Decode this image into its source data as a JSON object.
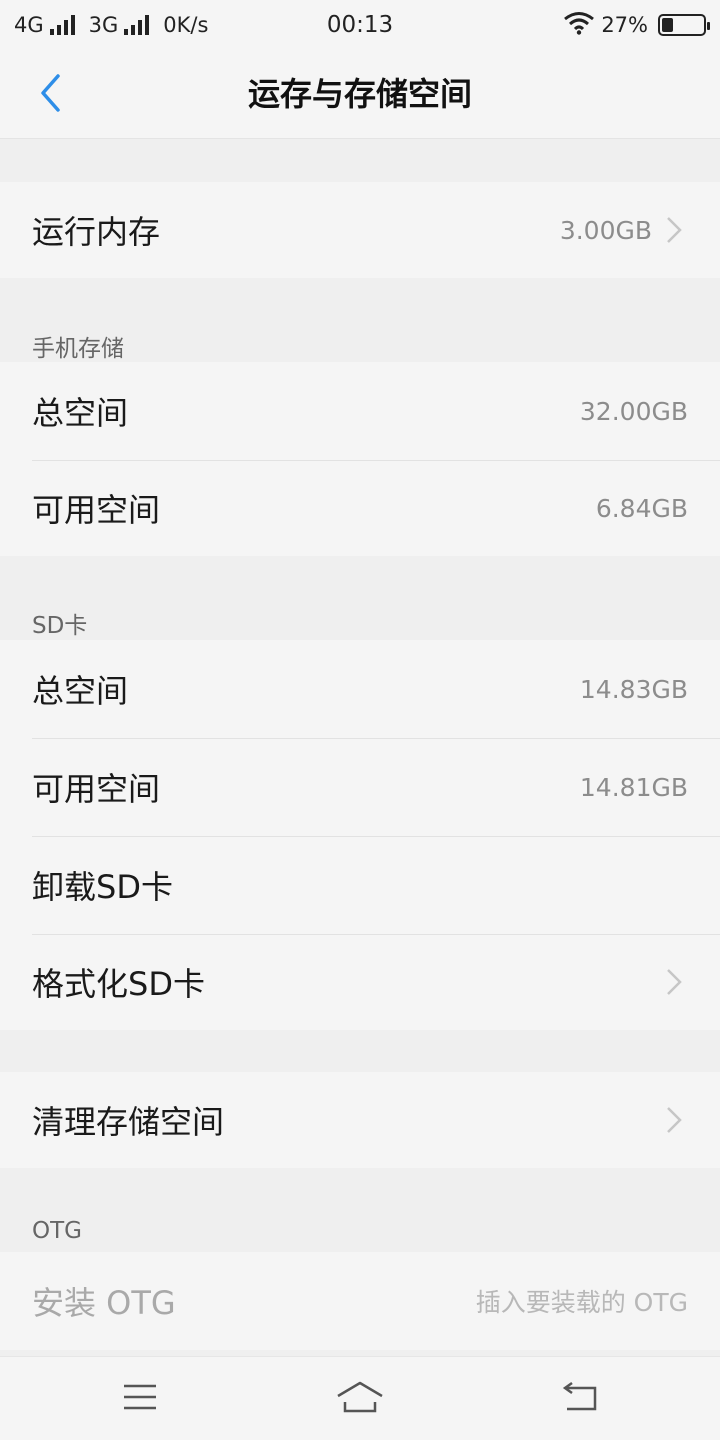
{
  "status_bar": {
    "network_1": "4G",
    "network_2": "3G",
    "speed": "0K/s",
    "time": "00:13",
    "battery_percent": "27%",
    "battery_level": 0.27
  },
  "header": {
    "title": "运存与存储空间",
    "back_icon": "chevron-left-icon",
    "accent_color": "#2e8ee8"
  },
  "ram": {
    "label": "运行内存",
    "value": "3.00GB"
  },
  "phone_storage": {
    "header": "手机存储",
    "total_label": "总空间",
    "total_value": "32.00GB",
    "available_label": "可用空间",
    "available_value": "6.84GB"
  },
  "sd_card": {
    "header": "SD卡",
    "total_label": "总空间",
    "total_value": "14.83GB",
    "available_label": "可用空间",
    "available_value": "14.81GB",
    "unmount_label": "卸载SD卡",
    "format_label": "格式化SD卡"
  },
  "cleanup": {
    "label": "清理存储空间"
  },
  "otg": {
    "header": "OTG",
    "install_label": "安装 OTG",
    "install_hint": "插入要装载的 OTG"
  },
  "nav": {
    "menu_icon": "menu-icon",
    "home_icon": "home-icon",
    "back_icon": "back-icon"
  }
}
